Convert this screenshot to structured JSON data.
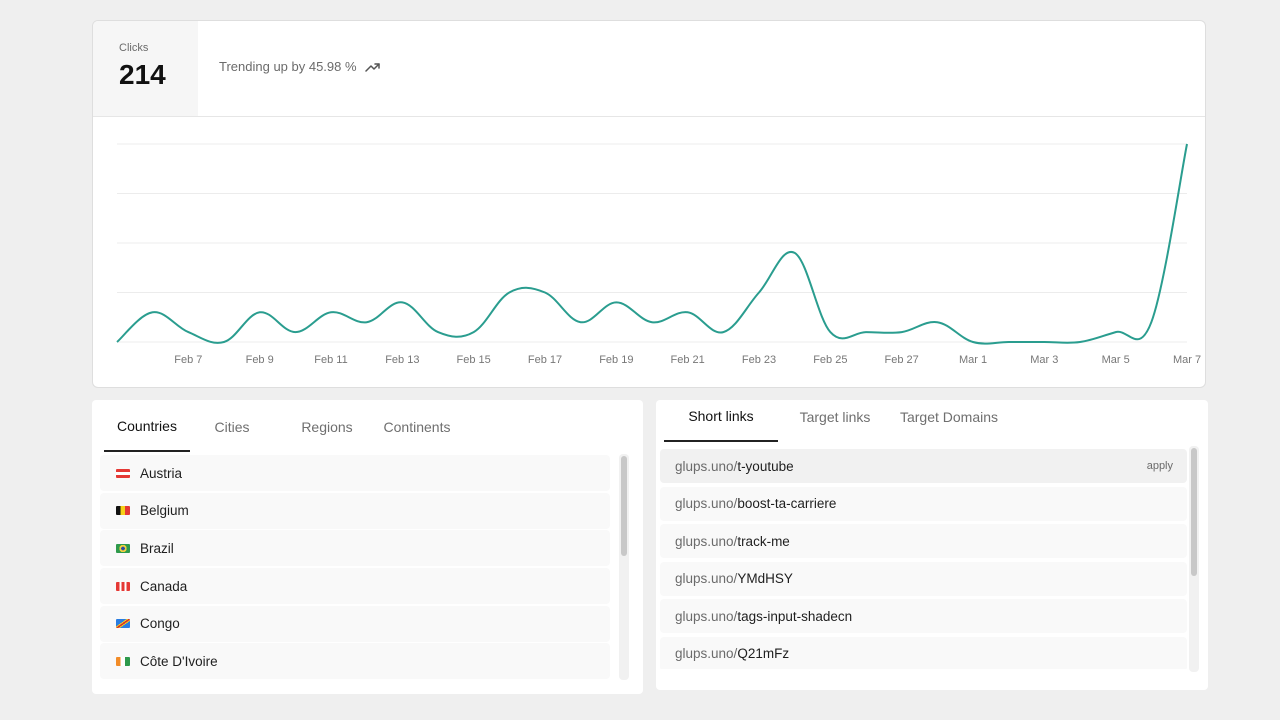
{
  "summary": {
    "label": "Clicks",
    "value": "214",
    "trend_text": "Trending up by 45.98 %",
    "trend_icon": "trending-up-icon"
  },
  "chart_data": {
    "type": "line",
    "title": "",
    "xlabel": "",
    "ylabel": "",
    "x": [
      "Feb 5",
      "Feb 6",
      "Feb 7",
      "Feb 8",
      "Feb 9",
      "Feb 10",
      "Feb 11",
      "Feb 12",
      "Feb 13",
      "Feb 14",
      "Feb 15",
      "Feb 16",
      "Feb 17",
      "Feb 18",
      "Feb 19",
      "Feb 20",
      "Feb 21",
      "Feb 22",
      "Feb 23",
      "Feb 24",
      "Feb 25",
      "Feb 26",
      "Feb 27",
      "Feb 28",
      "Mar 1",
      "Mar 2",
      "Mar 3",
      "Mar 4",
      "Mar 5",
      "Mar 6",
      "Mar 7"
    ],
    "tick_labels": [
      "Feb 7",
      "Feb 9",
      "Feb 11",
      "Feb 13",
      "Feb 15",
      "Feb 17",
      "Feb 19",
      "Feb 21",
      "Feb 23",
      "Feb 25",
      "Feb 27",
      "Mar 1",
      "Mar 3",
      "Mar 5",
      "Mar 7"
    ],
    "values": [
      0,
      3,
      1,
      0,
      3,
      1,
      3,
      2,
      4,
      1,
      1,
      5,
      5,
      2,
      4,
      2,
      3,
      1,
      5,
      9,
      1,
      1,
      1,
      2,
      0,
      0,
      0,
      0,
      1,
      2,
      20
    ],
    "ylim": [
      0,
      20
    ],
    "grid": true,
    "color": "#2a9d8f"
  },
  "countries": {
    "tabs": [
      "Countries",
      "Cities",
      "Regions",
      "Continents"
    ],
    "active": 0,
    "items": [
      {
        "name": "Austria",
        "flag": "flag-austria-icon"
      },
      {
        "name": "Belgium",
        "flag": "flag-belgium-icon"
      },
      {
        "name": "Brazil",
        "flag": "flag-brazil-icon"
      },
      {
        "name": "Canada",
        "flag": "flag-canada-icon"
      },
      {
        "name": "Congo",
        "flag": "flag-congo-icon"
      },
      {
        "name": "Côte D'Ivoire",
        "flag": "flag-cote-divoire-icon"
      }
    ]
  },
  "links": {
    "tabs": [
      "Short links",
      "Target links",
      "Target Domains"
    ],
    "active": 0,
    "items": [
      {
        "domain": "glups.uno/",
        "slug": "t-youtube",
        "action": "apply"
      },
      {
        "domain": "glups.uno/",
        "slug": "boost-ta-carriere"
      },
      {
        "domain": "glups.uno/",
        "slug": "track-me"
      },
      {
        "domain": "glups.uno/",
        "slug": "YMdHSY"
      },
      {
        "domain": "glups.uno/",
        "slug": "tags-input-shadecn"
      },
      {
        "domain": "glups.uno/",
        "slug": "Q21mFz"
      }
    ]
  }
}
